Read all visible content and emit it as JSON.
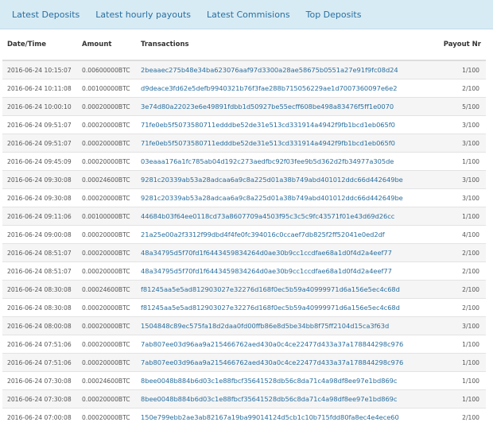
{
  "tabs": [
    "Latest Deposits",
    "Latest hourly payouts",
    "Latest Commisions",
    "Top Deposits"
  ],
  "table": {
    "headers": {
      "date": "Date/Time",
      "amount": "Amount",
      "tx": "Transactions",
      "payout": "Payout Nr"
    },
    "rows": [
      {
        "date": "2016-06-24 10:15:07",
        "amount": "0.00600000BTC",
        "tx": "2beaaec275b48e34ba623076aaf97d3300a28ae58675b0551a27e91f9fc08d24",
        "payout": "1/100"
      },
      {
        "date": "2016-06-24 10:11:08",
        "amount": "0.00100000BTC",
        "tx": "d9deace3fd62e5defb9940321b76f3fae288b715056229ae1d7007360097e6e2",
        "payout": "2/100"
      },
      {
        "date": "2016-06-24 10:00:10",
        "amount": "0.00020000BTC",
        "tx": "3e74d80a22023e6e49891fdbb1d50927be55ecff608be498a83476f5ff1e0070",
        "payout": "5/100"
      },
      {
        "date": "2016-06-24 09:51:07",
        "amount": "0.00020000BTC",
        "tx": "71fe0eb5f5073580711edddbe52de31e513cd331914a4942f9fb1bcd1eb065f0",
        "payout": "3/100"
      },
      {
        "date": "2016-06-24 09:51:07",
        "amount": "0.00020000BTC",
        "tx": "71fe0eb5f5073580711edddbe52de31e513cd331914a4942f9fb1bcd1eb065f0",
        "payout": "3/100"
      },
      {
        "date": "2016-06-24 09:45:09",
        "amount": "0.00020000BTC",
        "tx": "03eaaa176a1fc785ab04d192c273aedfbc92f03fee9b5d362d2fb34977a305de",
        "payout": "1/100"
      },
      {
        "date": "2016-06-24 09:30:08",
        "amount": "0.00024600BTC",
        "tx": "9281c20339ab53a28adcaa6a9c8a225d01a38b749abd401012ddc66d442649be",
        "payout": "3/100"
      },
      {
        "date": "2016-06-24 09:30:08",
        "amount": "0.00020000BTC",
        "tx": "9281c20339ab53a28adcaa6a9c8a225d01a38b749abd401012ddc66d442649be",
        "payout": "3/100"
      },
      {
        "date": "2016-06-24 09:11:06",
        "amount": "0.00100000BTC",
        "tx": "44684b03f64ee0118cd73a8607709a4503f95c3c5c9fc43571f01e43d69d26cc",
        "payout": "1/100"
      },
      {
        "date": "2016-06-24 09:00:08",
        "amount": "0.00020000BTC",
        "tx": "21a25e00a2f3312f99dbd4f4fe0fc394016c0ccaef7db825f2ff52041e0ed2df",
        "payout": "4/100"
      },
      {
        "date": "2016-06-24 08:51:07",
        "amount": "0.00020000BTC",
        "tx": "48a34795d5f70fd1f6443459834264d0ae30b9cc1ccdfae68a1d0f4d2a4eef77",
        "payout": "2/100"
      },
      {
        "date": "2016-06-24 08:51:07",
        "amount": "0.00020000BTC",
        "tx": "48a34795d5f70fd1f6443459834264d0ae30b9cc1ccdfae68a1d0f4d2a4eef77",
        "payout": "2/100"
      },
      {
        "date": "2016-06-24 08:30:08",
        "amount": "0.00024600BTC",
        "tx": "f81245aa5e5ad812903027e32276d168f0ec5b59a40999971d6a156e5ec4c68d",
        "payout": "2/100"
      },
      {
        "date": "2016-06-24 08:30:08",
        "amount": "0.00020000BTC",
        "tx": "f81245aa5e5ad812903027e32276d168f0ec5b59a40999971d6a156e5ec4c68d",
        "payout": "2/100"
      },
      {
        "date": "2016-06-24 08:00:08",
        "amount": "0.00020000BTC",
        "tx": "1504848c89ec575fa18d2daa0fd00ffb86e8d5be34bb8f75ff2104d15ca3f63d",
        "payout": "3/100"
      },
      {
        "date": "2016-06-24 07:51:06",
        "amount": "0.00020000BTC",
        "tx": "7ab807ee03d96aa9a215466762aed430a0c4ce22477d433a37a178844298c976",
        "payout": "1/100"
      },
      {
        "date": "2016-06-24 07:51:06",
        "amount": "0.00020000BTC",
        "tx": "7ab807ee03d96aa9a215466762aed430a0c4ce22477d433a37a178844298c976",
        "payout": "1/100"
      },
      {
        "date": "2016-06-24 07:30:08",
        "amount": "0.00024600BTC",
        "tx": "8bee0048b884b6d03c1e88fbcf35641528db56c8da71c4a98df8ee97e1bd869c",
        "payout": "1/100"
      },
      {
        "date": "2016-06-24 07:30:08",
        "amount": "0.00020000BTC",
        "tx": "8bee0048b884b6d03c1e88fbcf35641528db56c8da71c4a98df8ee97e1bd869c",
        "payout": "1/100"
      },
      {
        "date": "2016-06-24 07:00:08",
        "amount": "0.00020000BTC",
        "tx": "150e799ebb2ae3ab82167a19ba99014124d5cb1c10b715fdd80fa8ec4e4ece60",
        "payout": "2/100"
      }
    ]
  }
}
